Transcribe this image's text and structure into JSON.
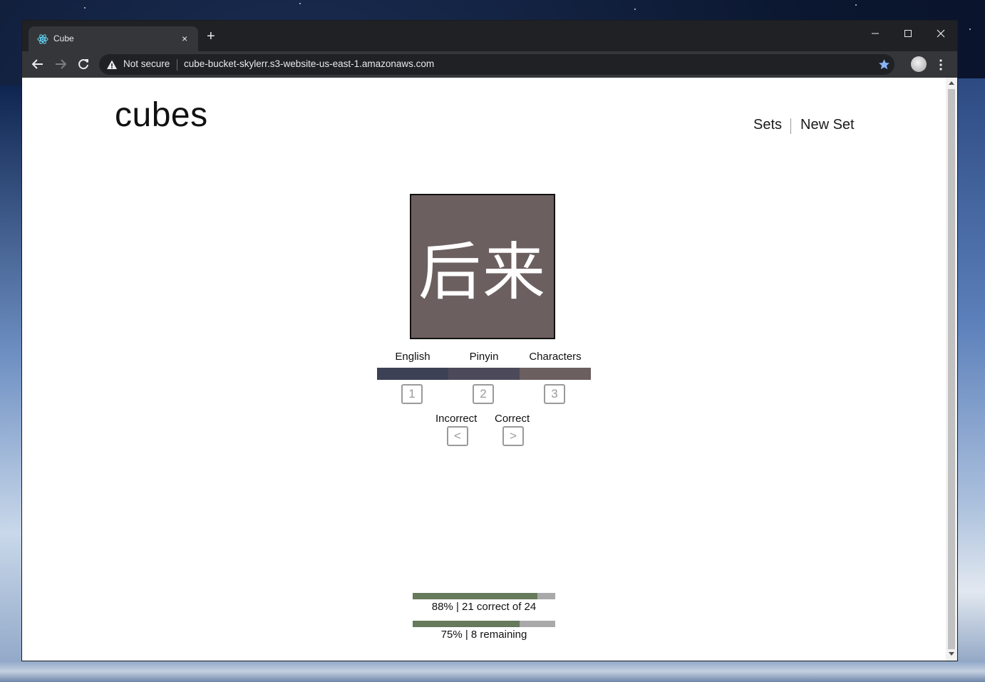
{
  "browser": {
    "tab_title": "Cube",
    "new_tab_symbol": "+",
    "close_symbol": "×",
    "security_label": "Not secure",
    "url": "cube-bucket-skylerr.s3-website-us-east-1.amazonaws.com"
  },
  "header": {
    "brand": "cubes",
    "nav": {
      "sets": "Sets",
      "new_set": "New Set"
    }
  },
  "card": {
    "text": "后来",
    "color": "#6c5f5f"
  },
  "faces": [
    {
      "label": "English",
      "key": "1",
      "color": "#3d4155"
    },
    {
      "label": "Pinyin",
      "key": "2",
      "color": "#4c495b"
    },
    {
      "label": "Characters",
      "key": "3",
      "color": "#6c5f5f"
    }
  ],
  "grading": {
    "incorrect": {
      "label": "Incorrect",
      "key": "<"
    },
    "correct": {
      "label": "Correct",
      "key": ">"
    }
  },
  "progress": {
    "accuracy": {
      "fraction": 0.875,
      "text": "88% | 21 correct of 24"
    },
    "completion": {
      "fraction": 0.75,
      "text": "75% | 8 remaining"
    },
    "fill_color": "#677a5c",
    "track_color": "#a9a9a9"
  }
}
